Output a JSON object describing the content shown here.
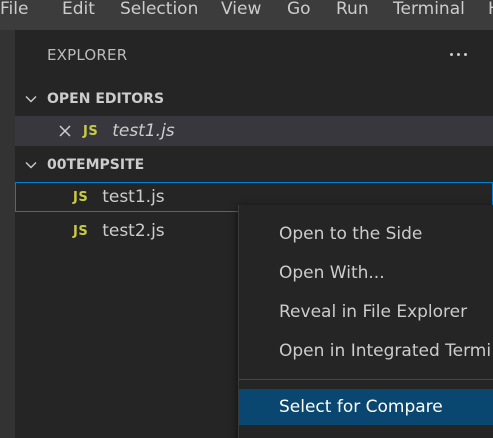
{
  "menubar": {
    "items": [
      "File",
      "Edit",
      "Selection",
      "View",
      "Go",
      "Run",
      "Terminal",
      "H"
    ]
  },
  "explorer": {
    "title": "EXPLORER",
    "more_icon": "ellipsis-icon",
    "open_editors": {
      "title": "OPEN EDITORS",
      "files": [
        {
          "badge": "JS",
          "name": "test1.js"
        }
      ]
    },
    "folder": {
      "title": "00TEMPSITE",
      "files": [
        {
          "badge": "JS",
          "name": "test1.js"
        },
        {
          "badge": "JS",
          "name": "test2.js"
        }
      ]
    }
  },
  "context_menu": {
    "items": [
      "Open to the Side",
      "Open With...",
      "Reveal in File Explorer",
      "Open in Integrated Termi",
      "Select for Compare"
    ]
  },
  "colors": {
    "accent": "#007fd4",
    "menu_highlight": "#094771",
    "js_badge": "#cbcb41"
  }
}
